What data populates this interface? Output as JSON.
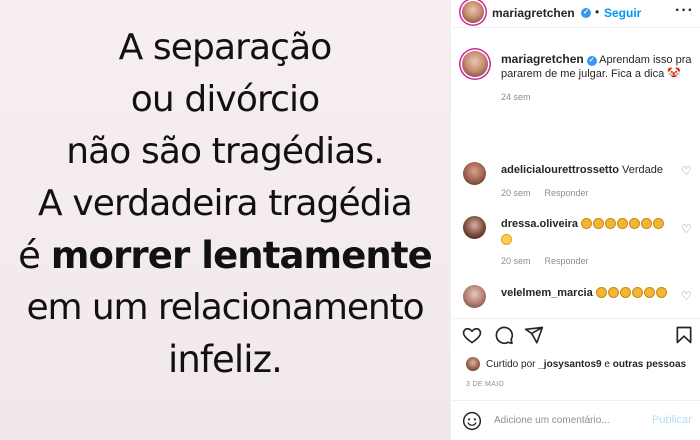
{
  "post": {
    "quote_lines": [
      "A separação",
      "ou divórcio",
      "não são tragédias.",
      "A verdadeira tragédia",
      "é ",
      "morrer lentamente",
      "em um relacionamento",
      "infeliz."
    ]
  },
  "header": {
    "username": "mariagretchen",
    "dot": "•",
    "follow_label": "Seguir",
    "more_label": "···"
  },
  "caption": {
    "username": "mariagretchen",
    "text": "Aprendam isso pra pararem de me julgar. Fica a dica 🤡",
    "time": "24 sem"
  },
  "comments": [
    {
      "username": "adelicialourettrossetto",
      "text": "Verdade",
      "time": "20 sem",
      "reply_label": "Responder"
    },
    {
      "username": "dressa.oliveira",
      "text": "",
      "time": "20 sem",
      "reply_label": "Responder"
    },
    {
      "username": "velelmem_marcia",
      "text": "",
      "time": "",
      "reply_label": ""
    }
  ],
  "likes": {
    "prefix": "Curtido por ",
    "user": "_josysantos9",
    "suffix": " e ",
    "others": "outras pessoas"
  },
  "date": "3 DE MAIO",
  "add_comment": {
    "placeholder": "Adicione um comentário...",
    "publish_label": "Publicar"
  },
  "colors": {
    "accent": "#0095f6",
    "verified": "#3897f0",
    "muted": "#8e8e8e",
    "publish_disabled": "#b2dffc"
  },
  "icons": [
    "heart-icon",
    "comment-icon",
    "share-icon",
    "bookmark-icon",
    "emoji-icon",
    "verified-icon"
  ]
}
